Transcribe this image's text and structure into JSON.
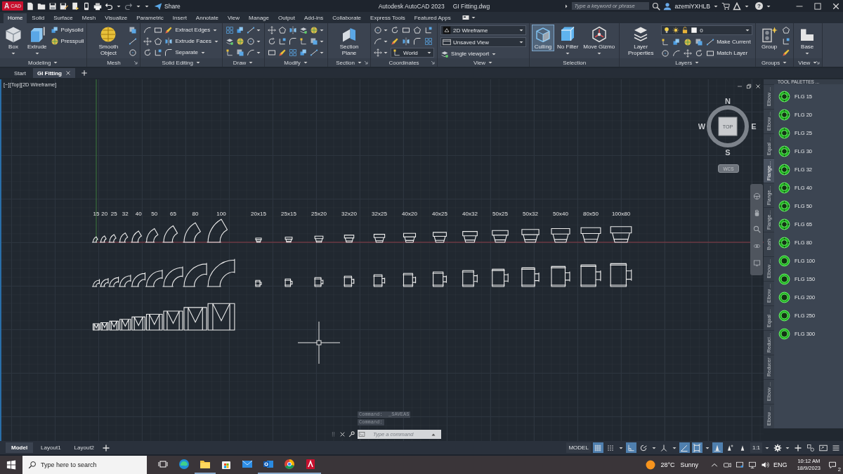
{
  "title_bar": {
    "logo_letter": "A",
    "logo_caption": "CAD",
    "share": "Share",
    "app_title": "Autodesk AutoCAD 2023",
    "file_title": "GI Fitting.dwg",
    "search": {
      "placeholder": "Type a keyword or phrase"
    },
    "user": "azemiYXHLB",
    "help": "?"
  },
  "ribbon_tabs": [
    {
      "label": "Home",
      "selected": true
    },
    {
      "label": "Solid",
      "selected": false
    },
    {
      "label": "Surface",
      "selected": false
    },
    {
      "label": "Mesh",
      "selected": false
    },
    {
      "label": "Visualize",
      "selected": false
    },
    {
      "label": "Parametric",
      "selected": false
    },
    {
      "label": "Insert",
      "selected": false
    },
    {
      "label": "Annotate",
      "selected": false
    },
    {
      "label": "View",
      "selected": false
    },
    {
      "label": "Manage",
      "selected": false
    },
    {
      "label": "Output",
      "selected": false
    },
    {
      "label": "Add-ins",
      "selected": false
    },
    {
      "label": "Collaborate",
      "selected": false
    },
    {
      "label": "Express Tools",
      "selected": false
    },
    {
      "label": "Featured Apps",
      "selected": false
    }
  ],
  "ribbon_panels": [
    {
      "title": "Modeling",
      "menu": true,
      "launcher": false,
      "columns": [
        [
          {
            "kind": "large",
            "label": "Box",
            "menu": true,
            "active": false
          }
        ],
        [
          {
            "kind": "large",
            "label": "Extrude",
            "menu": true,
            "active": false
          }
        ],
        [
          {
            "kind": "small",
            "label": "Polysolid",
            "menu": false
          },
          {
            "kind": "small",
            "label": "Presspull",
            "menu": false
          }
        ]
      ]
    },
    {
      "title": "Mesh",
      "menu": false,
      "launcher": true,
      "columns": [
        [
          {
            "kind": "large",
            "label": "Smooth Object",
            "menu": false,
            "active": false
          }
        ],
        [
          {
            "kind": "icon",
            "menu": false
          },
          {
            "kind": "icon",
            "menu": false
          },
          {
            "kind": "icon",
            "menu": false
          }
        ]
      ]
    },
    {
      "title": "Solid Editing",
      "menu": true,
      "launcher": false,
      "columns": [
        [
          {
            "kind": "icon",
            "menu": false
          },
          {
            "kind": "icon",
            "menu": false
          },
          {
            "kind": "icon",
            "menu": false
          }
        ],
        [
          {
            "kind": "icon",
            "menu": false
          },
          {
            "kind": "icon",
            "menu": false
          },
          {
            "kind": "icon",
            "menu": false
          }
        ],
        [
          {
            "kind": "small",
            "label": "Extract Edges",
            "menu": true
          },
          {
            "kind": "small",
            "label": "Extrude Faces",
            "menu": true
          },
          {
            "kind": "small",
            "label": "Separate",
            "menu": true
          }
        ]
      ]
    },
    {
      "title": "Draw",
      "menu": true,
      "launcher": false,
      "columns": [
        [
          {
            "kind": "icon",
            "menu": false
          },
          {
            "kind": "icon",
            "menu": false
          },
          {
            "kind": "icon",
            "menu": false
          }
        ],
        [
          {
            "kind": "icon",
            "menu": false
          },
          {
            "kind": "icon",
            "menu": false
          },
          {
            "kind": "icon",
            "menu": false
          }
        ],
        [
          {
            "kind": "icon",
            "menu": true
          },
          {
            "kind": "icon",
            "menu": true
          },
          {
            "kind": "icon",
            "menu": true
          }
        ]
      ]
    },
    {
      "title": "Modify",
      "menu": true,
      "launcher": false,
      "columns": [
        [
          {
            "kind": "icon",
            "menu": false
          },
          {
            "kind": "icon",
            "menu": false
          },
          {
            "kind": "icon",
            "menu": false
          }
        ],
        [
          {
            "kind": "icon",
            "menu": false
          },
          {
            "kind": "icon",
            "menu": false
          },
          {
            "kind": "icon",
            "menu": false
          }
        ],
        [
          {
            "kind": "icon",
            "menu": false
          },
          {
            "kind": "icon",
            "menu": false
          },
          {
            "kind": "icon",
            "menu": false
          }
        ],
        [
          {
            "kind": "icon",
            "menu": false
          },
          {
            "kind": "icon",
            "menu": false
          },
          {
            "kind": "icon",
            "menu": false
          }
        ],
        [
          {
            "kind": "icon",
            "menu": true
          },
          {
            "kind": "icon",
            "menu": true
          },
          {
            "kind": "icon",
            "menu": true
          }
        ]
      ]
    },
    {
      "title": "Section",
      "menu": true,
      "launcher": true,
      "columns": [
        [
          {
            "kind": "large",
            "label": "Section Plane",
            "menu": false,
            "active": false
          }
        ]
      ]
    },
    {
      "title": "Coordinates",
      "menu": false,
      "launcher": true,
      "columns": [
        [
          {
            "kind": "icon",
            "menu": true
          },
          {
            "kind": "icon",
            "menu": true
          },
          {
            "kind": "icon",
            "menu": true
          }
        ],
        [
          {
            "kind": "row",
            "items": [
              {
                "kind": "icon",
                "menu": false
              },
              {
                "kind": "icon",
                "menu": false
              },
              {
                "kind": "icon",
                "menu": false
              },
              {
                "kind": "icon",
                "menu": false
              }
            ]
          },
          {
            "kind": "row",
            "items": [
              {
                "kind": "icon",
                "menu": false
              },
              {
                "kind": "icon",
                "menu": false
              },
              {
                "kind": "icon",
                "menu": false
              },
              {
                "kind": "icon",
                "menu": false
              }
            ]
          },
          {
            "kind": "dropdown",
            "value": "World"
          }
        ]
      ]
    },
    {
      "title": "View",
      "menu": true,
      "launcher": false,
      "columns": [
        [
          {
            "kind": "dropdown",
            "value": "2D Wireframe"
          },
          {
            "kind": "dropdown",
            "value": "Unsaved View"
          },
          {
            "kind": "small",
            "label": "Single viewport",
            "menu": true
          }
        ]
      ]
    },
    {
      "title": "Selection",
      "menu": false,
      "launcher": false,
      "columns": [
        [
          {
            "kind": "large",
            "label": "Culling",
            "menu": false,
            "active": true
          }
        ],
        [
          {
            "kind": "large",
            "label": "No Filter",
            "menu": true,
            "active": false
          }
        ],
        [
          {
            "kind": "large",
            "label": "Move Gizmo",
            "menu": true,
            "active": false
          }
        ]
      ]
    },
    {
      "title": "Layers",
      "menu": true,
      "launcher": false,
      "columns": [
        [
          {
            "kind": "large",
            "label": "Layer Properties",
            "menu": false,
            "active": false
          }
        ],
        [
          {
            "kind": "layer_dropdown",
            "value": "0"
          },
          {
            "kind": "row",
            "items": [
              {
                "kind": "icon",
                "menu": false
              },
              {
                "kind": "icon",
                "menu": false
              },
              {
                "kind": "icon",
                "menu": false
              },
              {
                "kind": "icon",
                "menu": false
              },
              {
                "kind": "small",
                "label": "Make Current",
                "menu": false
              }
            ]
          },
          {
            "kind": "row",
            "items": [
              {
                "kind": "icon",
                "menu": false
              },
              {
                "kind": "icon",
                "menu": false
              },
              {
                "kind": "icon",
                "menu": false
              },
              {
                "kind": "icon",
                "menu": false
              },
              {
                "kind": "small",
                "label": "Match Layer",
                "menu": false
              }
            ]
          }
        ]
      ]
    },
    {
      "title": "Groups",
      "menu": true,
      "launcher": false,
      "columns": [
        [
          {
            "kind": "large",
            "label": "Group",
            "menu": false,
            "active": false
          }
        ],
        [
          {
            "kind": "icon",
            "menu": false
          },
          {
            "kind": "icon",
            "menu": false
          },
          {
            "kind": "icon",
            "menu": false
          }
        ]
      ]
    },
    {
      "title": "View",
      "menu": true,
      "launcher": true,
      "columns": [
        [
          {
            "kind": "large",
            "label": "Base",
            "menu": true,
            "active": false
          }
        ]
      ]
    }
  ],
  "file_tabs": [
    {
      "label": "Start",
      "selected": false,
      "closable": false
    },
    {
      "label": "GI Fitting",
      "selected": true,
      "closable": true
    }
  ],
  "viewport": {
    "controls_label": "[−][Top][2D Wireframe]",
    "compass": {
      "north": "N",
      "east": "E",
      "south": "S",
      "west": "W",
      "face": "TOP",
      "ucs": "WCS"
    },
    "columns": [
      {
        "label": "15",
        "kind": "equal"
      },
      {
        "label": "20",
        "kind": "equal"
      },
      {
        "label": "25",
        "kind": "equal"
      },
      {
        "label": "32",
        "kind": "equal"
      },
      {
        "label": "40",
        "kind": "equal"
      },
      {
        "label": "50",
        "kind": "equal"
      },
      {
        "label": "65",
        "kind": "equal"
      },
      {
        "label": "80",
        "kind": "equal"
      },
      {
        "label": "100",
        "kind": "equal"
      },
      {
        "label": "20x15",
        "kind": "reducing"
      },
      {
        "label": "25x15",
        "kind": "reducing"
      },
      {
        "label": "25x20",
        "kind": "reducing"
      },
      {
        "label": "32x20",
        "kind": "reducing"
      },
      {
        "label": "32x25",
        "kind": "reducing"
      },
      {
        "label": "40x20",
        "kind": "reducing"
      },
      {
        "label": "40x25",
        "kind": "reducing"
      },
      {
        "label": "40x32",
        "kind": "reducing"
      },
      {
        "label": "50x25",
        "kind": "reducing"
      },
      {
        "label": "50x32",
        "kind": "reducing"
      },
      {
        "label": "50x40",
        "kind": "reducing"
      },
      {
        "label": "80x50",
        "kind": "reducing"
      },
      {
        "label": "100x80",
        "kind": "reducing"
      }
    ],
    "command_history": [
      "Command:  _SAVEAS",
      "Command:"
    ],
    "command_line": {
      "placeholder": "Type a command"
    }
  },
  "tool_palette": {
    "title": "TOOL PALETTES ...",
    "tabs": [
      {
        "label": "Elbow ...",
        "selected": false
      },
      {
        "label": "Elbow ...",
        "selected": false
      },
      {
        "label": "Equal ...",
        "selected": false
      },
      {
        "label": "Flange...",
        "selected": true
      },
      {
        "label": "Flange...",
        "selected": false
      },
      {
        "label": "Flange...",
        "selected": false
      },
      {
        "label": "Bush",
        "selected": false
      },
      {
        "label": "Elbow ...",
        "selected": false
      },
      {
        "label": "Elbow ...",
        "selected": false
      },
      {
        "label": "Equal ...",
        "selected": false
      },
      {
        "label": "Reduci...",
        "selected": false
      },
      {
        "label": "Reducer",
        "selected": false
      },
      {
        "label": "Elbow ...",
        "selected": false
      },
      {
        "label": "Elbow ...",
        "selected": false
      }
    ],
    "items": [
      {
        "label": "FLG 15"
      },
      {
        "label": "FLG 20"
      },
      {
        "label": "FLG 25"
      },
      {
        "label": "FLG 30"
      },
      {
        "label": "FLG 32"
      },
      {
        "label": "FLG 40"
      },
      {
        "label": "FLG 50"
      },
      {
        "label": "FLG 65"
      },
      {
        "label": "FLG 80"
      },
      {
        "label": "FLG 100"
      },
      {
        "label": "FLG 150"
      },
      {
        "label": "FLG 200"
      },
      {
        "label": "FLG 250"
      },
      {
        "label": "FLG 300"
      }
    ]
  },
  "layout_tabs": [
    {
      "label": "Model",
      "selected": true
    },
    {
      "label": "Layout1",
      "selected": false
    },
    {
      "label": "Layout2",
      "selected": false
    }
  ],
  "status_tools": [
    {
      "kind": "text",
      "label": "MODEL",
      "on": false
    },
    {
      "kind": "icon",
      "on": true
    },
    {
      "kind": "icon",
      "on": false
    },
    {
      "kind": "caret"
    },
    {
      "kind": "icon",
      "on": true
    },
    {
      "kind": "icon",
      "on": false
    },
    {
      "kind": "caret"
    },
    {
      "kind": "icon",
      "on": false
    },
    {
      "kind": "caret"
    },
    {
      "kind": "icon",
      "on": true
    },
    {
      "kind": "icon",
      "on": true
    },
    {
      "kind": "caret"
    },
    {
      "kind": "icon",
      "on": true
    },
    {
      "kind": "icon",
      "on": false
    },
    {
      "kind": "icon",
      "on": false
    },
    {
      "kind": "text",
      "label": "1:1",
      "on": false
    },
    {
      "kind": "caret"
    },
    {
      "kind": "icon",
      "on": false
    },
    {
      "kind": "caret"
    },
    {
      "kind": "icon",
      "on": false
    },
    {
      "kind": "icon",
      "on": false
    },
    {
      "kind": "icon",
      "on": false
    },
    {
      "kind": "icon",
      "on": false
    }
  ],
  "taskbar": {
    "search": {
      "placeholder": "Type here to search"
    },
    "apps": [
      {
        "running": false
      },
      {
        "running": false
      },
      {
        "running": true
      },
      {
        "running": false
      },
      {
        "running": false
      },
      {
        "running": true
      },
      {
        "running": true
      },
      {
        "running": true
      }
    ],
    "weather": {
      "temperature": "28°C",
      "condition": "Sunny"
    },
    "language": "ENG",
    "time": "10:12 AM",
    "date": "18/9/2023",
    "notifications": "2"
  }
}
